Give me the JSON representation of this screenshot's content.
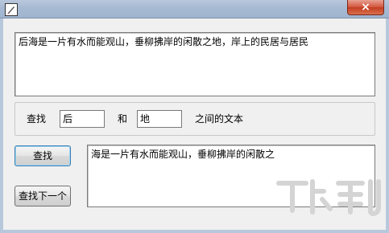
{
  "window": {
    "close_glyph": "×",
    "icon": "app-icon"
  },
  "source_text": "后海是一片有水而能观山，垂柳拂岸的闲散之地，岸上的民居与居民",
  "search": {
    "label_find": "查找",
    "start_value": "后",
    "label_and": "和",
    "end_value": "地",
    "label_between": "之间的文本"
  },
  "buttons": {
    "find": "查找",
    "find_next": "查找下一个"
  },
  "result_text": "海是一片有水而能观山，垂柳拂岸的闲散之",
  "watermark": {
    "brand_text": "下载吧"
  }
}
